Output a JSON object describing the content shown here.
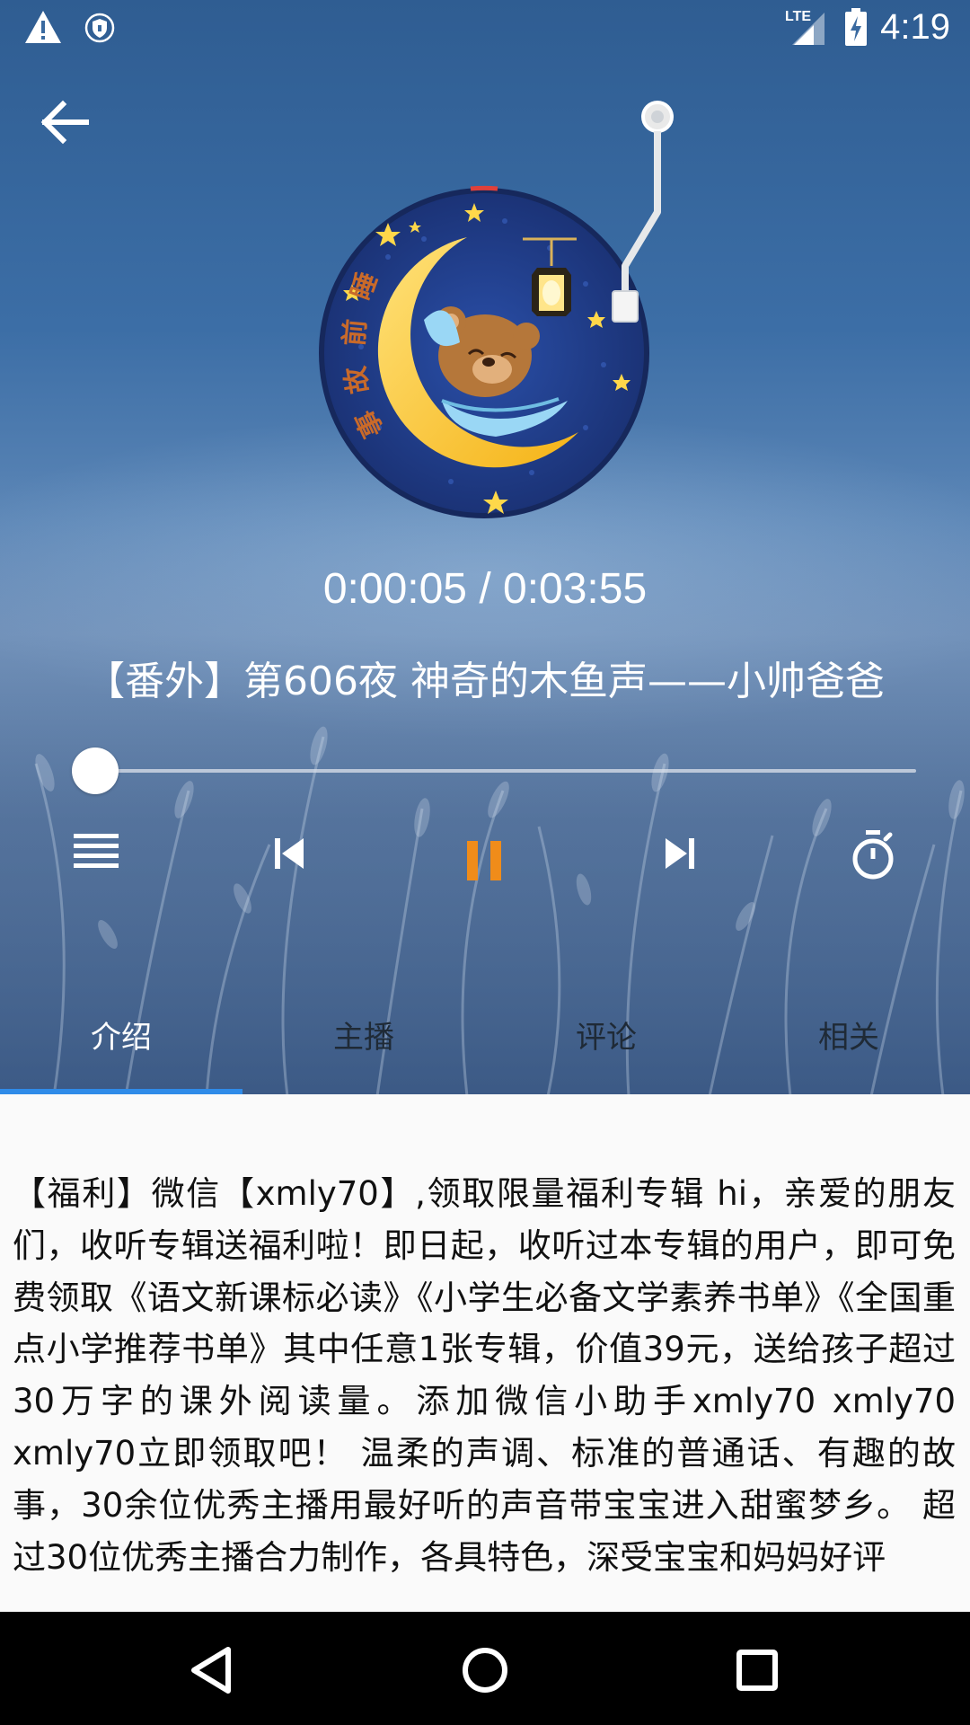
{
  "status_bar": {
    "time": "4:19",
    "network_label": "LTE",
    "icons": [
      "warning-icon",
      "vpn-shield-icon",
      "lte-signal-icon",
      "battery-charging-icon"
    ]
  },
  "player": {
    "back_icon": "arrow-left-icon",
    "cover_icon": "moon-bear-cover-art",
    "time_display": "0:00:05 / 0:03:55",
    "track_title": "【番外】第606夜 神奇的木鱼声——小帅爸爸",
    "progress_fraction": 0.021,
    "controls": {
      "playlist_icon": "playlist-icon",
      "previous_icon": "skip-previous-icon",
      "play_state_icon": "pause-icon",
      "next_icon": "skip-next-icon",
      "timer_icon": "sleep-timer-icon"
    },
    "accent_color": "#f08c1a"
  },
  "tabs": {
    "items": [
      {
        "label": "介绍",
        "active": true
      },
      {
        "label": "主播",
        "active": false
      },
      {
        "label": "评论",
        "active": false
      },
      {
        "label": "相关",
        "active": false
      }
    ],
    "indicator_color": "#2f8be8"
  },
  "description": {
    "text": "【福利】微信【xmly70】,领取限量福利专辑 hi，亲爱的朋友们，收听专辑送福利啦！即日起，收听过本专辑的用户，即可免费领取《语文新课标必读》《小学生必备文学素养书单》《全国重点小学推荐书单》其中任意1张专辑，价值39元，送给孩子超过30万字的课外阅读量。添加微信小助手xmly70 xmly70 xmly70立即领取吧！ 温柔的声调、标准的普通话、有趣的故事，30余位优秀主播用最好听的声音带宝宝进入甜蜜梦乡。 超过30位优秀主播合力制作，各具特色，深受宝宝和妈妈好评"
  },
  "nav_bar": {
    "back_icon": "nav-back-icon",
    "home_icon": "nav-home-icon",
    "recents_icon": "nav-recents-icon"
  }
}
